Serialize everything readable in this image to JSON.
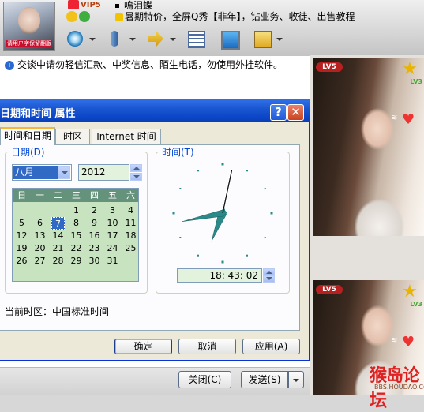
{
  "chat": {
    "vip_label": "VIP5",
    "nickname": "鳴泪蝶",
    "signature": "暑期特价，全屏Q秀【非年】，钻业务、收徒、出售教程",
    "avatar_caption": "请用户字保留翻版",
    "notice": "交谈中请勿轻信汇款、中奖信息、陌生电话，勿使用外挂软件。",
    "close_label": "关闭(C)",
    "send_label": "发送(S)",
    "video_badges": {
      "level": "LV5",
      "level_small": "LV3"
    },
    "watermark": "猴岛论坛",
    "watermark_url": "BBS.HOUDAO.COM",
    "toolbar_icons": [
      "webcam-icon",
      "microphone-icon",
      "file-transfer-icon",
      "app-add-icon",
      "remote-desktop-icon",
      "note-icon"
    ]
  },
  "dialog": {
    "title": "日期和时间 属性",
    "help_label": "?",
    "close_label": "✕",
    "tabs": [
      "时间和日期",
      "时区",
      "Internet 时间"
    ],
    "date_group_label": "日期(D)",
    "time_group_label": "时间(T)",
    "month_value": "八月",
    "year_value": "2012",
    "weekday_headers": [
      "日",
      "一",
      "二",
      "三",
      "四",
      "五",
      "六"
    ],
    "weeks": [
      [
        "",
        "",
        "",
        "1",
        "2",
        "3",
        "4"
      ],
      [
        "5",
        "6",
        "7",
        "8",
        "9",
        "10",
        "11"
      ],
      [
        "12",
        "13",
        "14",
        "15",
        "16",
        "17",
        "18"
      ],
      [
        "19",
        "20",
        "21",
        "22",
        "23",
        "24",
        "25"
      ],
      [
        "26",
        "27",
        "28",
        "29",
        "30",
        "31",
        ""
      ]
    ],
    "selected_day": "7",
    "time_value": "18: 43: 02",
    "timezone_label": "当前时区：中国标准时间",
    "ok_label": "确定",
    "cancel_label": "取消",
    "apply_label": "应用(A)"
  },
  "colors": {
    "titlebar": "#0b45c8",
    "calendar_header": "#64927a",
    "calendar_bg": "#c8e3c0",
    "clock_hand": "#2a8a8a",
    "selection": "#316ac5"
  }
}
